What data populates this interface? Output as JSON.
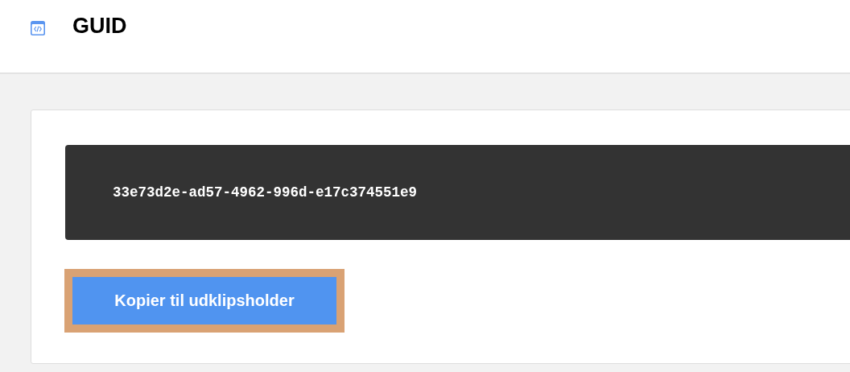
{
  "header": {
    "title": "GUID"
  },
  "guid": {
    "value": "33e73d2e-ad57-4962-996d-e17c374551e9"
  },
  "copy_button": {
    "label": "Kopier til udklipsholder",
    "focused": true
  }
}
